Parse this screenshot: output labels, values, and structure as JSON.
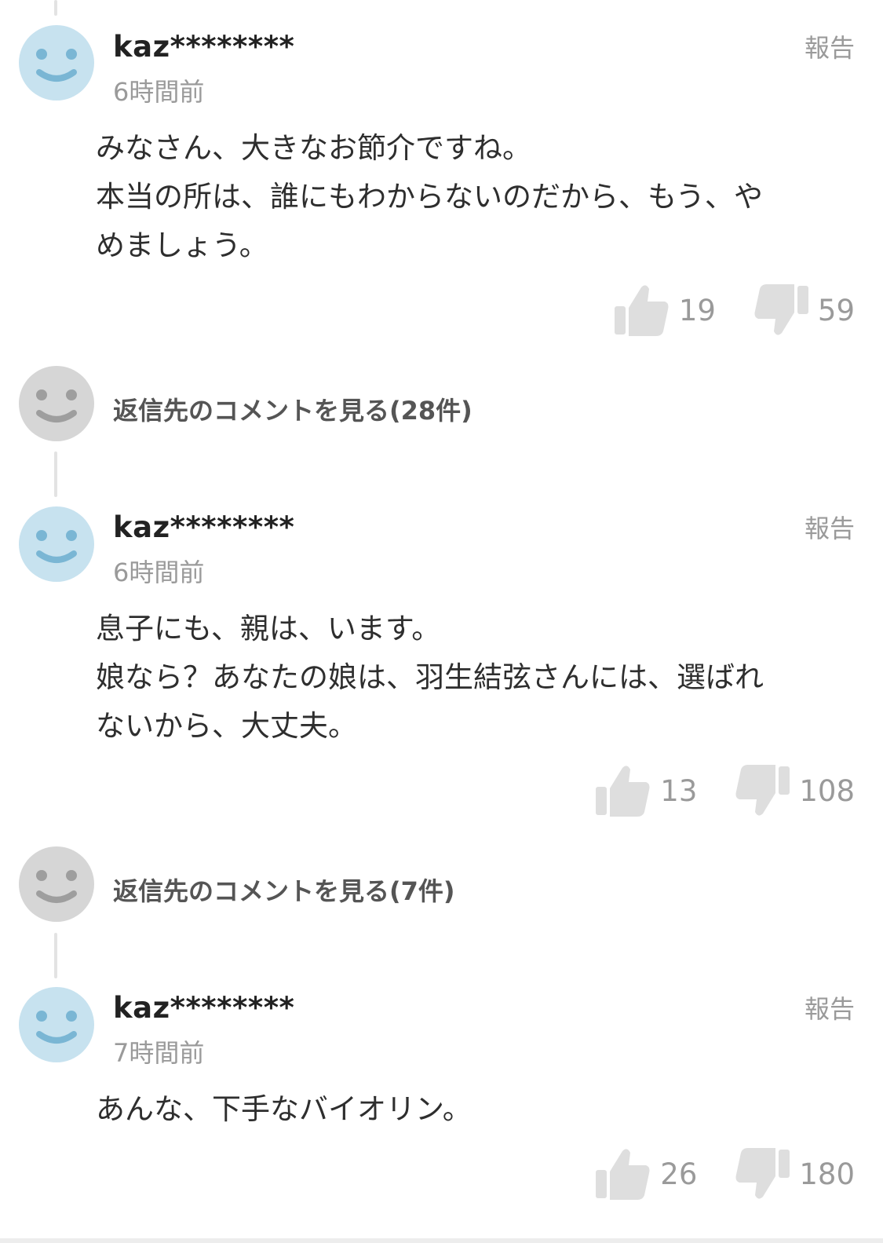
{
  "comments": [
    {
      "username": "kaz********",
      "time": "6時間前",
      "report_label": "報告",
      "body": [
        "みなさん、大きなお節介ですね。",
        "本当の所は、誰にもわからないのだから、もう、や",
        "めましょう。"
      ],
      "likes": "19",
      "dislikes": "59"
    },
    {
      "username": "kaz********",
      "time": "6時間前",
      "report_label": "報告",
      "body": [
        "息子にも、親は、います。",
        "娘なら？あなたの娘は、羽生結弦さんには、選ばれ",
        "ないから、大丈夫。"
      ],
      "likes": "13",
      "dislikes": "108"
    },
    {
      "username": "kaz********",
      "time": "7時間前",
      "report_label": "報告",
      "body": [
        "あんな、下手なバイオリン。"
      ],
      "likes": "26",
      "dislikes": "180"
    }
  ],
  "reply_links": [
    {
      "label": "返信先のコメントを見る(28件)"
    },
    {
      "label": "返信先のコメントを見る(7件)"
    }
  ],
  "colors": {
    "avatar_blue": "#c7e2ef",
    "avatar_blue_face": "#7ab6d4",
    "avatar_gray": "#d6d6d6",
    "avatar_gray_face": "#9e9e9e",
    "muted_text": "#9a9a9a",
    "vote_icon": "#dedede"
  },
  "icons": {
    "avatar": "smiley-face-icon",
    "like": "thumbs-up-icon",
    "dislike": "thumbs-down-icon"
  }
}
